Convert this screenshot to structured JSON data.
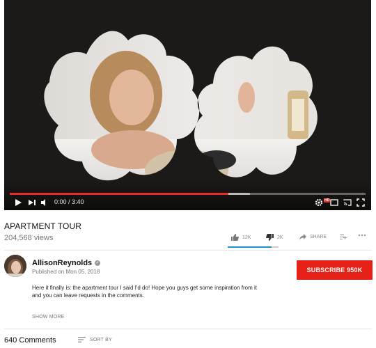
{
  "player": {
    "time_display": "0:00 / 3:40",
    "progress_played": 0.615,
    "progress_buffered": 0.675,
    "hd_badge": "HD"
  },
  "video": {
    "title": "APARTMENT TOUR",
    "views": "204,568 views",
    "likes": "12K",
    "dislikes": "2K",
    "share_label": "SHARE",
    "like_ratio": 0.86
  },
  "channel": {
    "name": "AllisonReynolds",
    "published": "Published on Mon 05, 2018",
    "subscribe_label": "SUBSCRIBE 950K",
    "description": "Here it finally is: the apartment tour I said I'd do! Hope you guys get some inspiration from it and you can leave requests in the comments.",
    "show_more_label": "SHOW MORE"
  },
  "comments": {
    "count_label": "640 Comments",
    "sort_label": "SORT BY"
  },
  "colors": {
    "accent_red": "#e62117",
    "like_blue": "#1f92d6"
  }
}
